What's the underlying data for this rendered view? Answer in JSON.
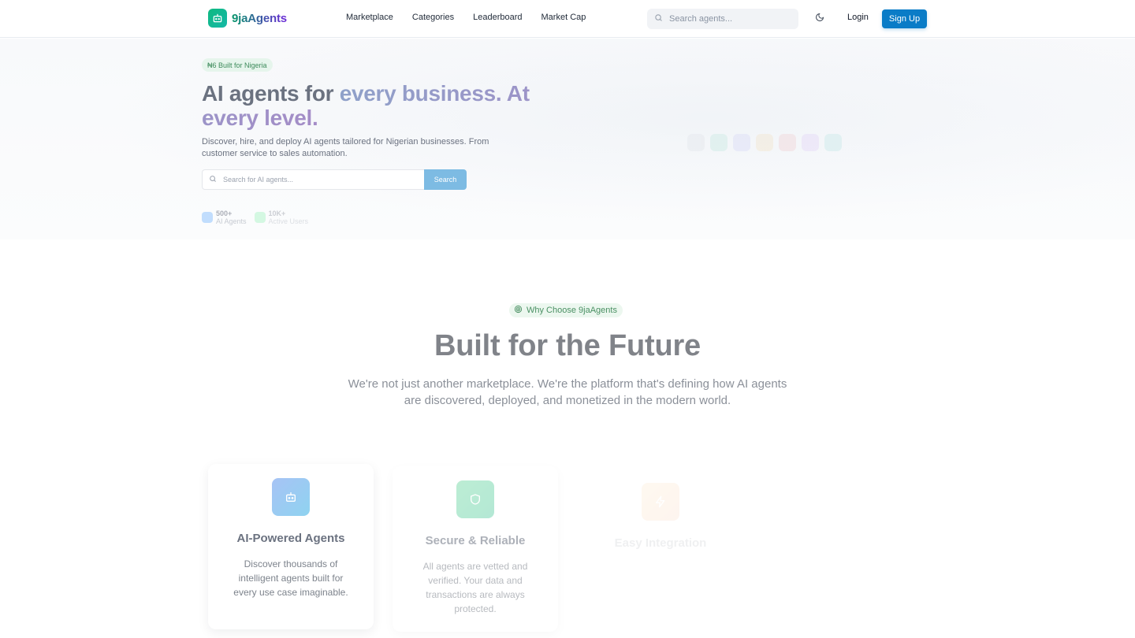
{
  "header": {
    "brand": "9jaAgents",
    "nav": [
      "Marketplace",
      "Categories",
      "Leaderboard",
      "Market Cap"
    ],
    "search_placeholder": "Search agents...",
    "login": "Login",
    "signup": "Sign Up"
  },
  "hero": {
    "badge": "₦6 Built for Nigeria",
    "headline_plain": "AI agents for ",
    "headline_gradient": "every business. At every level.",
    "subtext": "Discover, hire, and deploy AI agents tailored for Nigerian businesses. From customer service to sales automation.",
    "search_placeholder": "Search for AI agents...",
    "search_button": "Search",
    "stats": [
      {
        "value": "500+",
        "label": "AI Agents"
      },
      {
        "value": "10K+",
        "label": "Active Users"
      }
    ]
  },
  "why": {
    "badge": "Why Choose 9jaAgents",
    "title": "Built for the Future",
    "subtitle": "We're not just another marketplace. We're the platform that's defining how AI agents are discovered, deployed, and monetized in the modern world.",
    "cards": [
      {
        "icon": "robot-icon",
        "title": "AI-Powered Agents",
        "description": "Discover thousands of intelligent agents built for every use case imaginable."
      },
      {
        "icon": "shield-icon",
        "title": "Secure & Reliable",
        "description": "All agents are vetted and verified. Your data and transactions are always protected."
      },
      {
        "icon": "lightning-icon",
        "title": "Easy Integration"
      }
    ]
  },
  "colors": {
    "primary": "#0a7cc7",
    "brand_green": "#10b981",
    "brand_purple": "#6d28d9"
  }
}
